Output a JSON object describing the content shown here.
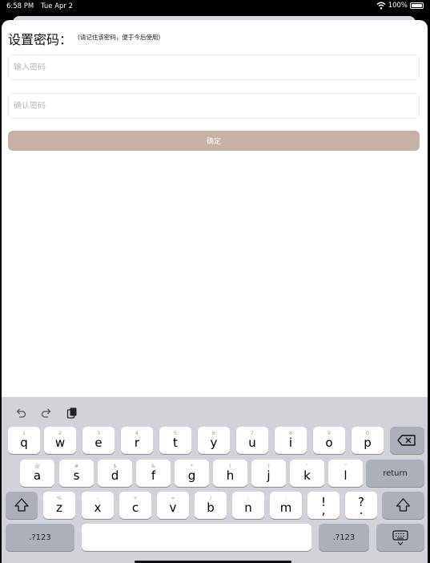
{
  "status_bar": {
    "time": "6:58 PM",
    "date": "Tue Apr 2",
    "battery": "100%"
  },
  "form": {
    "title": "设置密码：",
    "note": "(请记住该密码，便于今后使用)",
    "password_placeholder": "输入密码",
    "confirm_placeholder": "确认密码",
    "submit_label": "确定"
  },
  "keyboard": {
    "row1": [
      {
        "sub": "1",
        "main": "q"
      },
      {
        "sub": "2",
        "main": "w"
      },
      {
        "sub": "3",
        "main": "e"
      },
      {
        "sub": "4",
        "main": "r"
      },
      {
        "sub": "5",
        "main": "t"
      },
      {
        "sub": "6",
        "main": "y"
      },
      {
        "sub": "7",
        "main": "u"
      },
      {
        "sub": "8",
        "main": "i"
      },
      {
        "sub": "9",
        "main": "o"
      },
      {
        "sub": "0",
        "main": "p"
      }
    ],
    "row2": [
      {
        "sub": "@",
        "main": "a"
      },
      {
        "sub": "#",
        "main": "s"
      },
      {
        "sub": "$",
        "main": "d"
      },
      {
        "sub": "&",
        "main": "f"
      },
      {
        "sub": "*",
        "main": "g"
      },
      {
        "sub": "(",
        "main": "h"
      },
      {
        "sub": ")",
        "main": "j"
      },
      {
        "sub": "’",
        "main": "k"
      },
      {
        "sub": "”",
        "main": "l"
      }
    ],
    "row3": [
      {
        "sub": "%",
        "main": "z"
      },
      {
        "sub": "-",
        "main": "x"
      },
      {
        "sub": "+",
        "main": "c"
      },
      {
        "sub": "=",
        "main": "v"
      },
      {
        "sub": "/",
        "main": "b"
      },
      {
        "sub": ";",
        "main": "n"
      },
      {
        "sub": ":",
        "main": "m"
      },
      {
        "sub": "!",
        "main": ","
      },
      {
        "sub": "?",
        "main": "."
      }
    ],
    "return_label": "return",
    "numbers_label": ".?123",
    "colors": {
      "background": "#d1d3d9",
      "key": "#ffffff",
      "special_key": "#abb0ba",
      "accent_button": "#c7b0a4"
    }
  }
}
